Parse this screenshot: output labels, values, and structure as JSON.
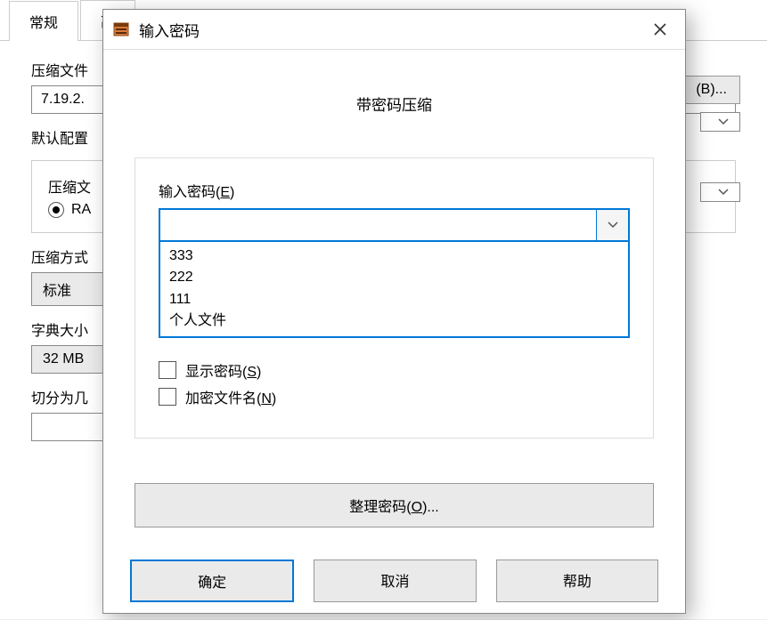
{
  "bg": {
    "tabs": [
      "常规",
      "高"
    ],
    "archive_file_label": "压缩文件",
    "archive_file_value": "7.19.2.",
    "default_profile_label": "默认配置",
    "browse_btn": "(B)...",
    "format_legend": "压缩文",
    "radio_rar": "RA",
    "method_label": "压缩方式",
    "method_value": "标准",
    "dict_label": "字典大小",
    "dict_value": "32 MB",
    "split_label": "切分为几"
  },
  "modal": {
    "title": "输入密码",
    "heading": "带密码压缩",
    "pwd_label_pre": "输入密码(",
    "pwd_label_u": "E",
    "pwd_label_post": ")",
    "pwd_value": "",
    "pwd_options": [
      "333",
      "222",
      "111",
      "个人文件"
    ],
    "show_pwd_pre": "显示密码(",
    "show_pwd_u": "S",
    "show_pwd_post": ")",
    "encrypt_names_pre": "加密文件名(",
    "encrypt_names_u": "N",
    "encrypt_names_post": ")",
    "manage_pre": "整理密码(",
    "manage_u": "O",
    "manage_post": ")...",
    "ok": "确定",
    "cancel": "取消",
    "help": "帮助"
  }
}
